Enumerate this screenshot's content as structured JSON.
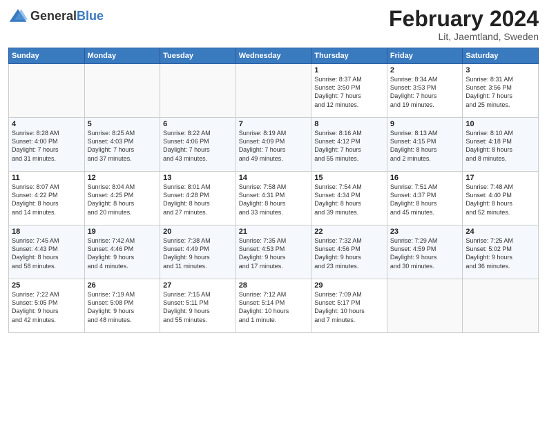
{
  "header": {
    "logo_general": "General",
    "logo_blue": "Blue",
    "title": "February 2024",
    "subtitle": "Lit, Jaemtland, Sweden"
  },
  "columns": [
    "Sunday",
    "Monday",
    "Tuesday",
    "Wednesday",
    "Thursday",
    "Friday",
    "Saturday"
  ],
  "weeks": [
    [
      {
        "day": "",
        "info": ""
      },
      {
        "day": "",
        "info": ""
      },
      {
        "day": "",
        "info": ""
      },
      {
        "day": "",
        "info": ""
      },
      {
        "day": "1",
        "info": "Sunrise: 8:37 AM\nSunset: 3:50 PM\nDaylight: 7 hours\nand 12 minutes."
      },
      {
        "day": "2",
        "info": "Sunrise: 8:34 AM\nSunset: 3:53 PM\nDaylight: 7 hours\nand 19 minutes."
      },
      {
        "day": "3",
        "info": "Sunrise: 8:31 AM\nSunset: 3:56 PM\nDaylight: 7 hours\nand 25 minutes."
      }
    ],
    [
      {
        "day": "4",
        "info": "Sunrise: 8:28 AM\nSunset: 4:00 PM\nDaylight: 7 hours\nand 31 minutes."
      },
      {
        "day": "5",
        "info": "Sunrise: 8:25 AM\nSunset: 4:03 PM\nDaylight: 7 hours\nand 37 minutes."
      },
      {
        "day": "6",
        "info": "Sunrise: 8:22 AM\nSunset: 4:06 PM\nDaylight: 7 hours\nand 43 minutes."
      },
      {
        "day": "7",
        "info": "Sunrise: 8:19 AM\nSunset: 4:09 PM\nDaylight: 7 hours\nand 49 minutes."
      },
      {
        "day": "8",
        "info": "Sunrise: 8:16 AM\nSunset: 4:12 PM\nDaylight: 7 hours\nand 55 minutes."
      },
      {
        "day": "9",
        "info": "Sunrise: 8:13 AM\nSunset: 4:15 PM\nDaylight: 8 hours\nand 2 minutes."
      },
      {
        "day": "10",
        "info": "Sunrise: 8:10 AM\nSunset: 4:18 PM\nDaylight: 8 hours\nand 8 minutes."
      }
    ],
    [
      {
        "day": "11",
        "info": "Sunrise: 8:07 AM\nSunset: 4:22 PM\nDaylight: 8 hours\nand 14 minutes."
      },
      {
        "day": "12",
        "info": "Sunrise: 8:04 AM\nSunset: 4:25 PM\nDaylight: 8 hours\nand 20 minutes."
      },
      {
        "day": "13",
        "info": "Sunrise: 8:01 AM\nSunset: 4:28 PM\nDaylight: 8 hours\nand 27 minutes."
      },
      {
        "day": "14",
        "info": "Sunrise: 7:58 AM\nSunset: 4:31 PM\nDaylight: 8 hours\nand 33 minutes."
      },
      {
        "day": "15",
        "info": "Sunrise: 7:54 AM\nSunset: 4:34 PM\nDaylight: 8 hours\nand 39 minutes."
      },
      {
        "day": "16",
        "info": "Sunrise: 7:51 AM\nSunset: 4:37 PM\nDaylight: 8 hours\nand 45 minutes."
      },
      {
        "day": "17",
        "info": "Sunrise: 7:48 AM\nSunset: 4:40 PM\nDaylight: 8 hours\nand 52 minutes."
      }
    ],
    [
      {
        "day": "18",
        "info": "Sunrise: 7:45 AM\nSunset: 4:43 PM\nDaylight: 8 hours\nand 58 minutes."
      },
      {
        "day": "19",
        "info": "Sunrise: 7:42 AM\nSunset: 4:46 PM\nDaylight: 9 hours\nand 4 minutes."
      },
      {
        "day": "20",
        "info": "Sunrise: 7:38 AM\nSunset: 4:49 PM\nDaylight: 9 hours\nand 11 minutes."
      },
      {
        "day": "21",
        "info": "Sunrise: 7:35 AM\nSunset: 4:53 PM\nDaylight: 9 hours\nand 17 minutes."
      },
      {
        "day": "22",
        "info": "Sunrise: 7:32 AM\nSunset: 4:56 PM\nDaylight: 9 hours\nand 23 minutes."
      },
      {
        "day": "23",
        "info": "Sunrise: 7:29 AM\nSunset: 4:59 PM\nDaylight: 9 hours\nand 30 minutes."
      },
      {
        "day": "24",
        "info": "Sunrise: 7:25 AM\nSunset: 5:02 PM\nDaylight: 9 hours\nand 36 minutes."
      }
    ],
    [
      {
        "day": "25",
        "info": "Sunrise: 7:22 AM\nSunset: 5:05 PM\nDaylight: 9 hours\nand 42 minutes."
      },
      {
        "day": "26",
        "info": "Sunrise: 7:19 AM\nSunset: 5:08 PM\nDaylight: 9 hours\nand 48 minutes."
      },
      {
        "day": "27",
        "info": "Sunrise: 7:15 AM\nSunset: 5:11 PM\nDaylight: 9 hours\nand 55 minutes."
      },
      {
        "day": "28",
        "info": "Sunrise: 7:12 AM\nSunset: 5:14 PM\nDaylight: 10 hours\nand 1 minute."
      },
      {
        "day": "29",
        "info": "Sunrise: 7:09 AM\nSunset: 5:17 PM\nDaylight: 10 hours\nand 7 minutes."
      },
      {
        "day": "",
        "info": ""
      },
      {
        "day": "",
        "info": ""
      }
    ]
  ]
}
